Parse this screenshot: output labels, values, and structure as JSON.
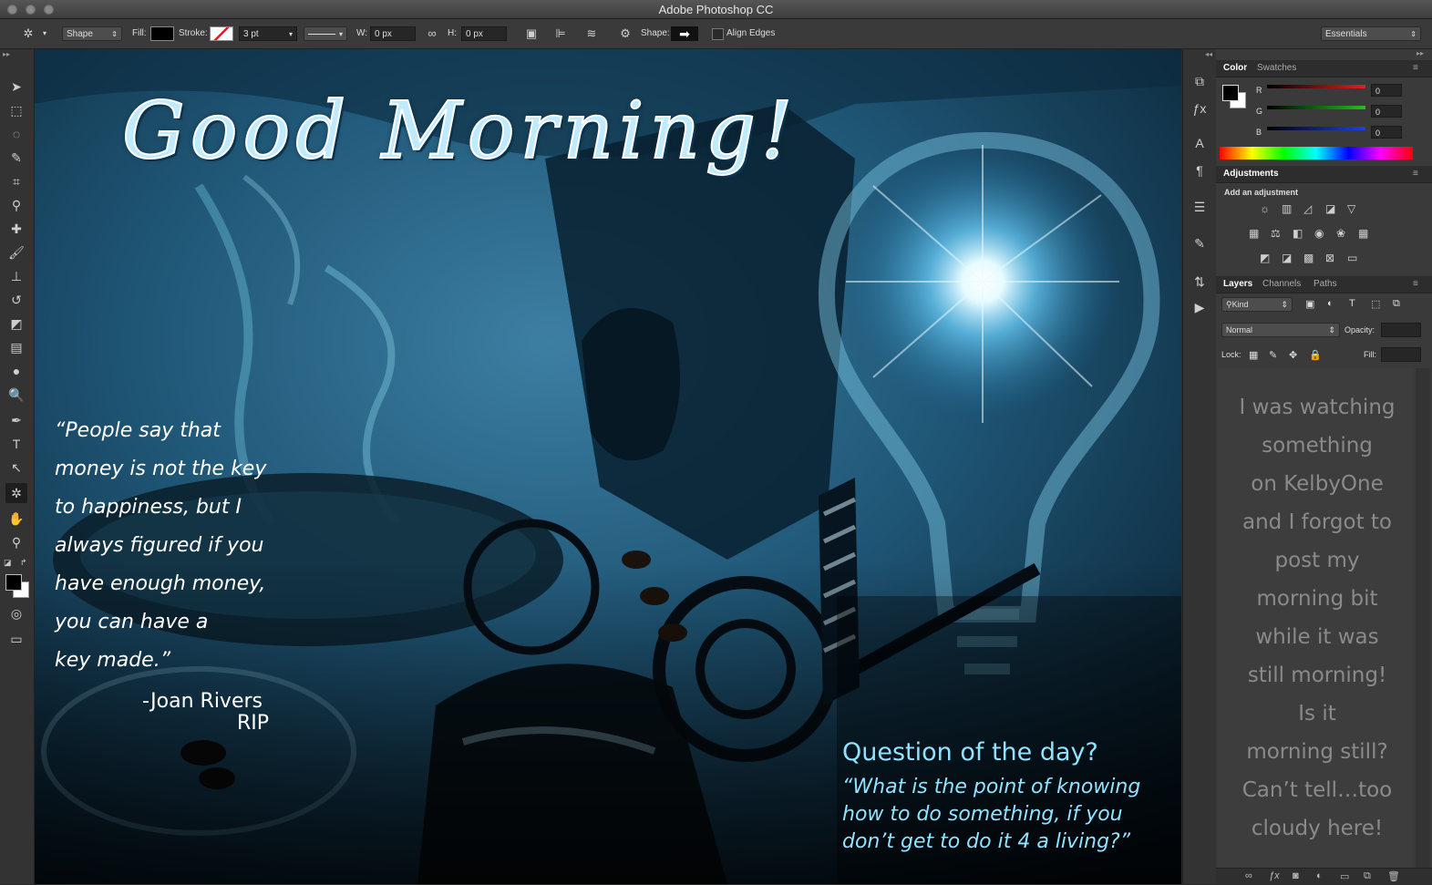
{
  "window": {
    "title": "Adobe Photoshop CC"
  },
  "options_bar": {
    "tool_mode": "Shape",
    "fill_label": "Fill:",
    "stroke_label": "Stroke:",
    "stroke_width": "3 pt",
    "w_label": "W:",
    "w_value": "0 px",
    "h_label": "H:",
    "h_value": "0 px",
    "shape_label": "Shape:",
    "align_edges_label": "Align Edges",
    "workspace": "Essentials"
  },
  "canvas": {
    "headline": "Good Morning!",
    "quote_lines": [
      "“People say that",
      "money is not the key",
      "to happiness, but I",
      "always figured if you",
      "have enough money,",
      "you can have a",
      "key made.”"
    ],
    "quote_author": "-Joan Rivers",
    "quote_author_note": "RIP",
    "question_title": "Question of the day?",
    "question_lines": [
      "“What is the point of knowing",
      "how to do something, if you",
      "don’t get to do it 4 a living?”"
    ]
  },
  "color_panel": {
    "tabs": [
      "Color",
      "Swatches"
    ],
    "channels": [
      {
        "label": "R",
        "value": "0",
        "color": "#e02020"
      },
      {
        "label": "G",
        "value": "0",
        "color": "#20c020"
      },
      {
        "label": "B",
        "value": "0",
        "color": "#2040e0"
      }
    ]
  },
  "adjustments_panel": {
    "tab": "Adjustments",
    "heading": "Add an adjustment"
  },
  "layers_panel": {
    "tabs": [
      "Layers",
      "Channels",
      "Paths"
    ],
    "filter_kind": "Kind",
    "blend_mode": "Normal",
    "opacity_label": "Opacity:",
    "lock_label": "Lock:",
    "fill_label": "Fill:",
    "overlay_lines": [
      "I was watching",
      "something",
      "on KelbyOne",
      "and I forgot to",
      "post my",
      "morning bit",
      "while it was",
      "still morning!",
      "Is it",
      "morning still?",
      "Can’t tell…too",
      "cloudy here!"
    ]
  }
}
